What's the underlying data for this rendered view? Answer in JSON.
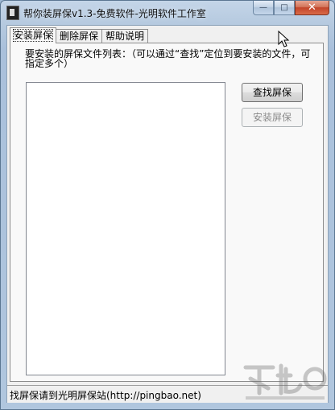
{
  "window": {
    "title": "帮你装屏保v1.3-免费软件-光明软件工作室",
    "minimize_glyph": "—",
    "maximize_glyph": "□",
    "close_glyph": "✕"
  },
  "tabs": [
    {
      "label": "安装屏保",
      "active": true
    },
    {
      "label": "删除屏保",
      "active": false
    },
    {
      "label": "帮助说明",
      "active": false
    }
  ],
  "install_panel": {
    "instruction": "要安装的屏保文件列表：（可以通过“查找”定位到要安装的文件，可指定多个）",
    "find_button": "查找屏保",
    "install_button": "安装屏保",
    "install_button_enabled": false,
    "file_list": []
  },
  "statusbar": {
    "text": "找屏保请到光明屏保站(http://pingbao.net)"
  },
  "icons": {
    "app": "app-icon",
    "cursor": "mouse-pointer-icon",
    "watermark": "site-logo-watermark"
  },
  "colors": {
    "frame": "#b5c9df",
    "close_button": "#c2442a",
    "panel": "#f9f9f9"
  }
}
